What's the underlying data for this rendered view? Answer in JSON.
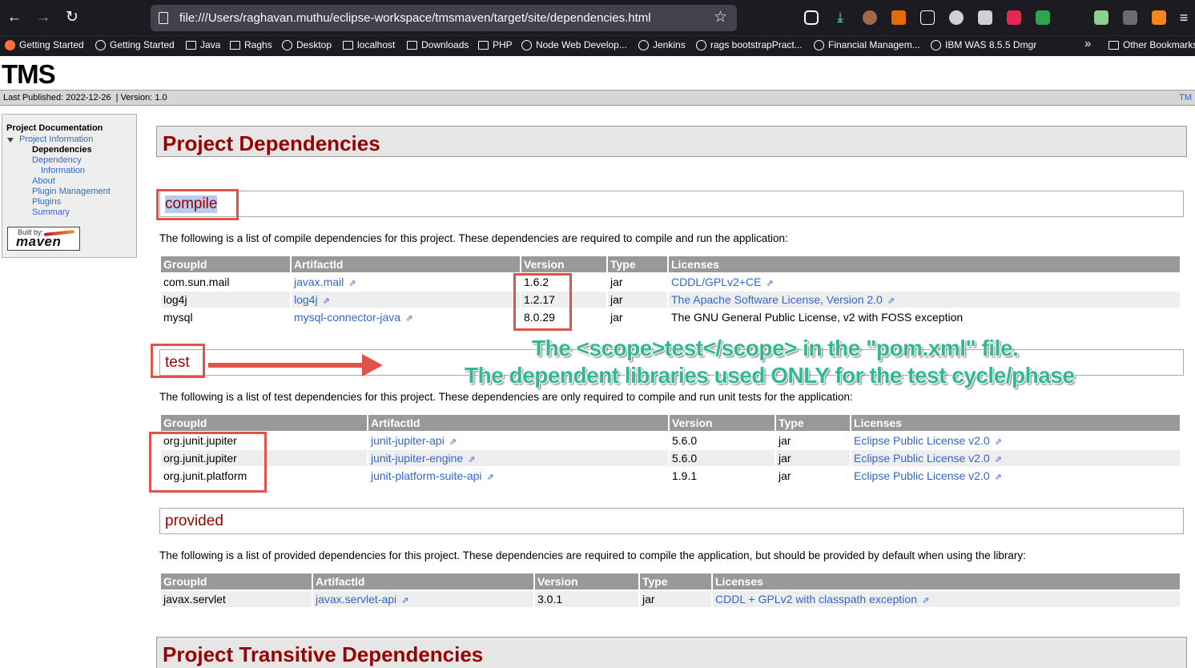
{
  "browser": {
    "url": "file:///Users/raghavan.muthu/eclipse-workspace/tmsmaven/target/site/dependencies.html",
    "bookmarks": [
      {
        "label": "Getting Started",
        "icon": "firefox-icon"
      },
      {
        "label": "Getting Started",
        "icon": "globe-icon"
      },
      {
        "label": "Java",
        "icon": "folder-icon"
      },
      {
        "label": "Raghs",
        "icon": "folder-icon"
      },
      {
        "label": "Desktop",
        "icon": "globe-icon"
      },
      {
        "label": "localhost",
        "icon": "folder-icon"
      },
      {
        "label": "Downloads",
        "icon": "folder-icon"
      },
      {
        "label": "PHP",
        "icon": "folder-icon"
      },
      {
        "label": "Node Web Develop...",
        "icon": "globe-icon"
      },
      {
        "label": "Jenkins",
        "icon": "globe-icon"
      },
      {
        "label": "rags bootstrapPract...",
        "icon": "globe-icon"
      },
      {
        "label": "Financial Managem...",
        "icon": "globe-icon"
      },
      {
        "label": "IBM WAS 8.5.5 Dmgr",
        "icon": "globe-icon"
      }
    ],
    "other_bookmarks": "Other Bookmarks"
  },
  "site": {
    "title": "TMS",
    "published": "Last Published: 2022-12-26  | Version: 1.0",
    "top_right_link": "TM"
  },
  "sidebar": {
    "heading": "Project Documentation",
    "project_info": "Project Information",
    "items": [
      "Dependencies",
      "Dependency",
      "Information",
      "About",
      "Plugin Management",
      "Plugins",
      "Summary"
    ],
    "badge_built": "Built by:",
    "badge_word": "maven"
  },
  "main": {
    "title": "Project Dependencies",
    "columns": [
      "GroupId",
      "ArtifactId",
      "Version",
      "Type",
      "Licenses"
    ],
    "compile": {
      "heading": "compile",
      "intro": "The following is a list of compile dependencies for this project. These dependencies are required to compile and run the application:",
      "rows": [
        [
          "com.sun.mail",
          "javax.mail",
          "1.6.2",
          "jar",
          "CDDL/GPLv2+CE"
        ],
        [
          "log4j",
          "log4j",
          "1.2.17",
          "jar",
          "The Apache Software License, Version 2.0"
        ],
        [
          "mysql",
          "mysql-connector-java",
          "8.0.29",
          "jar",
          "The GNU General Public License, v2 with FOSS exception"
        ]
      ]
    },
    "test": {
      "heading": "test",
      "intro": "The following is a list of test dependencies for this project. These dependencies are only required to compile and run unit tests for the application:",
      "rows": [
        [
          "org.junit.jupiter",
          "junit-jupiter-api",
          "5.6.0",
          "jar",
          "Eclipse Public License v2.0"
        ],
        [
          "org.junit.jupiter",
          "junit-jupiter-engine",
          "5.6.0",
          "jar",
          "Eclipse Public License v2.0"
        ],
        [
          "org.junit.platform",
          "junit-platform-suite-api",
          "1.9.1",
          "jar",
          "Eclipse Public License v2.0"
        ]
      ]
    },
    "provided": {
      "heading": "provided",
      "intro": "The following is a list of provided dependencies for this project. These dependencies are required to compile the application, but should be provided by default when using the library:",
      "rows": [
        [
          "javax.servlet",
          "javax.servlet-api",
          "3.0.1",
          "jar",
          "CDDL + GPLv2 with classpath exception"
        ]
      ]
    },
    "transitive_title": "Project Transitive Dependencies"
  },
  "annotation": {
    "line1": "The <scope>test</scope> in the \"pom.xml\" file.",
    "line2": "The dependent libraries used ONLY for the test cycle/phase"
  },
  "colors": {
    "heading_red": "#990000",
    "link_blue": "#3366cc",
    "annot_green": "#33b893",
    "box_red": "#e0524b"
  }
}
